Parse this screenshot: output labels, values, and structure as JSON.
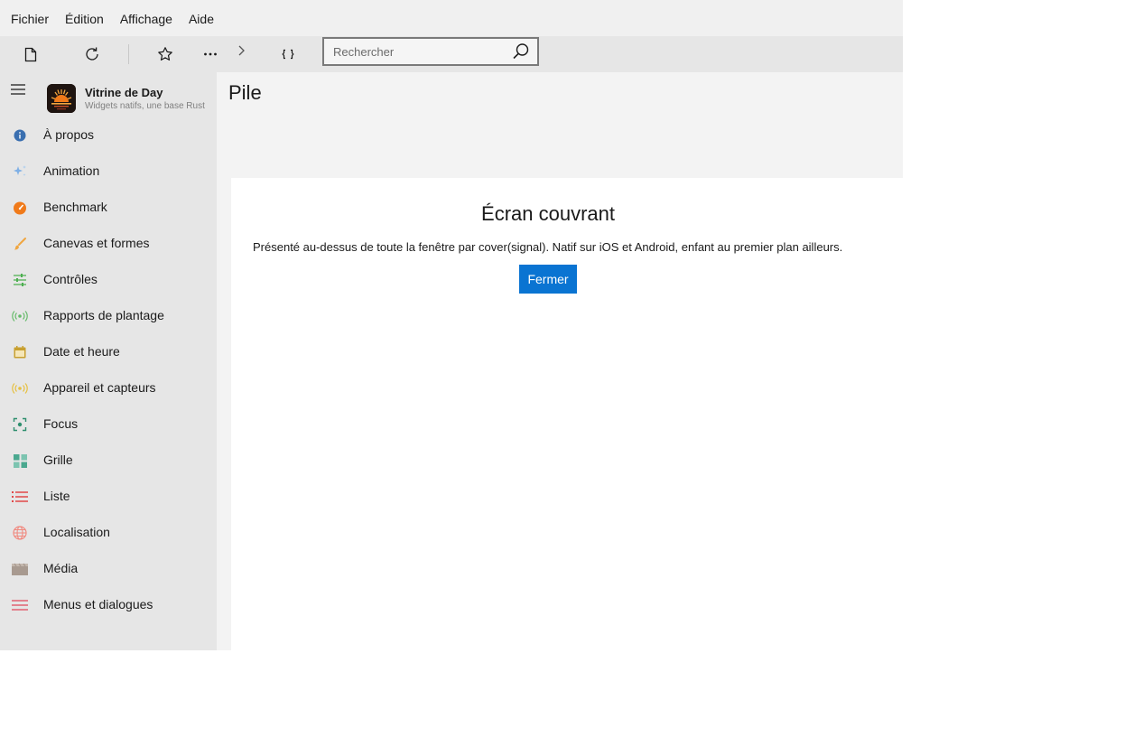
{
  "menubar": {
    "items": [
      {
        "label": "Fichier"
      },
      {
        "label": "Édition"
      },
      {
        "label": "Affichage"
      },
      {
        "label": "Aide"
      }
    ]
  },
  "toolbar": {
    "buttons": [
      {
        "icon": "document-icon"
      },
      {
        "icon": "refresh-icon"
      },
      {
        "icon": "star-icon"
      },
      {
        "icon": "more-icon"
      },
      {
        "icon": "chevron-right-icon"
      },
      {
        "icon": "code-braces-icon"
      }
    ],
    "search": {
      "placeholder": "Rechercher",
      "value": "",
      "icon": "search-icon"
    }
  },
  "sidebar": {
    "app_title": "Vitrine de Day",
    "app_subtitle": "Widgets natifs, une base Rust",
    "items": [
      {
        "label": "À propos",
        "icon": "info-icon",
        "color": "#3a6fb0"
      },
      {
        "label": "Animation",
        "icon": "sparkle-icon",
        "color": "#7fb0e6"
      },
      {
        "label": "Benchmark",
        "icon": "gauge-icon",
        "color": "#f07a1a"
      },
      {
        "label": "Canevas et formes",
        "icon": "brush-icon",
        "color": "#f0a640"
      },
      {
        "label": "Contrôles",
        "icon": "sliders-icon",
        "color": "#4caf50"
      },
      {
        "label": "Rapports de plantage",
        "icon": "broadcast-icon",
        "color": "#66bb6a"
      },
      {
        "label": "Date et heure",
        "icon": "calendar-icon",
        "color": "#c8a030"
      },
      {
        "label": "Appareil et capteurs",
        "icon": "sensor-icon",
        "color": "#e6c040"
      },
      {
        "label": "Focus",
        "icon": "focus-icon",
        "color": "#2e8f6e"
      },
      {
        "label": "Grille",
        "icon": "grid-icon",
        "color": "#4aa88f"
      },
      {
        "label": "Liste",
        "icon": "list-icon",
        "color": "#e04848"
      },
      {
        "label": "Localisation",
        "icon": "globe-icon",
        "color": "#f08a80"
      },
      {
        "label": "Média",
        "icon": "clapperboard-icon",
        "color": "#a89a90"
      },
      {
        "label": "Menus et dialogues",
        "icon": "menu-lines-icon",
        "color": "#e06070"
      }
    ]
  },
  "main": {
    "page_title": "Pile",
    "cover": {
      "title": "Écran couvrant",
      "description": "Présenté au-dessus de toute la fenêtre par cover(signal). Natif sur iOS et Android, enfant au premier plan ailleurs.",
      "close_label": "Fermer",
      "button_color": "#0a74d2"
    }
  }
}
